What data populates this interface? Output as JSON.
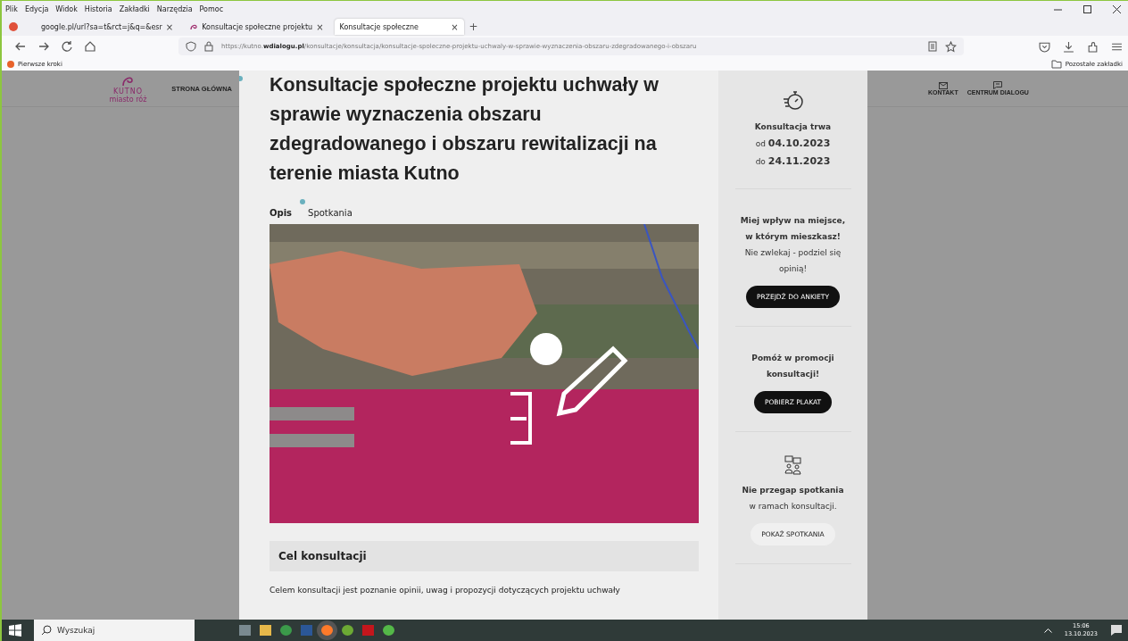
{
  "menu_bar": [
    "Plik",
    "Edycja",
    "Widok",
    "Historia",
    "Zakładki",
    "Narzędzia",
    "Pomoc"
  ],
  "tabs": [
    {
      "label": "google.pl/url?sa=t&rct=j&q=&esr",
      "selected": false,
      "kind": "plain"
    },
    {
      "label": "Konsultacje społeczne projektu",
      "selected": false,
      "kind": "site"
    },
    {
      "label": "Konsultacje społeczne",
      "selected": true,
      "kind": "none"
    }
  ],
  "tab_close": "×",
  "new_tab": "+",
  "address": {
    "prefix": "https://kutno.",
    "domain": "wdialogu.pl",
    "path": "/konsultacje/konsultacja/konsultacje-spoleczne-projektu-uchwaly-w-sprawie-wyznaczenia-obszaru-zdegradowanego-i-obszaru"
  },
  "bookmarks": {
    "left": "Pierwsze kroki",
    "right": "Pozostałe zakładki"
  },
  "site_nav": {
    "logo": "KUTNO",
    "logo_sub": "miasto róż",
    "home": "STRONA GŁÓWNA",
    "right": [
      "KONTAKT",
      "CENTRUM DIALOGU"
    ]
  },
  "page": {
    "title": "Konsultacje społeczne projektu uchwały w sprawie wyznaczenia obszaru zdegradowanego i obszaru rewitalizacji na terenie miasta Kutno",
    "tabs": [
      {
        "label": "Opis",
        "selected": true
      },
      {
        "label": "Spotkania",
        "selected": false
      }
    ],
    "section_heading": "Cel konsultacji",
    "paragraph": "Celem konsultacji jest poznanie opinii, uwag i propozycji dotyczących projektu uchwały"
  },
  "sidebar": {
    "duration_label": "Konsultacja trwa",
    "from_prefix": "od",
    "from_date": "04.10.2023",
    "to_prefix": "do",
    "to_date": "24.11.2023",
    "survey_heading": "Miej wpływ na miejsce, w którym mieszkasz!",
    "survey_text": "Nie zwlekaj - podziel się opinią!",
    "survey_button": "PRZEJDŹ DO ANKIETY",
    "promo_heading": "Pomóż w promocji konsultacji!",
    "promo_button": "POBIERZ PLAKAT",
    "meetings_heading": "Nie przegap spotkania",
    "meetings_text": "w ramach konsultacji.",
    "meetings_button": "POKAŻ SPOTKANIA"
  },
  "taskbar": {
    "search_placeholder": "Wyszukaj",
    "time": "15:06",
    "date": "13.10.2023"
  }
}
